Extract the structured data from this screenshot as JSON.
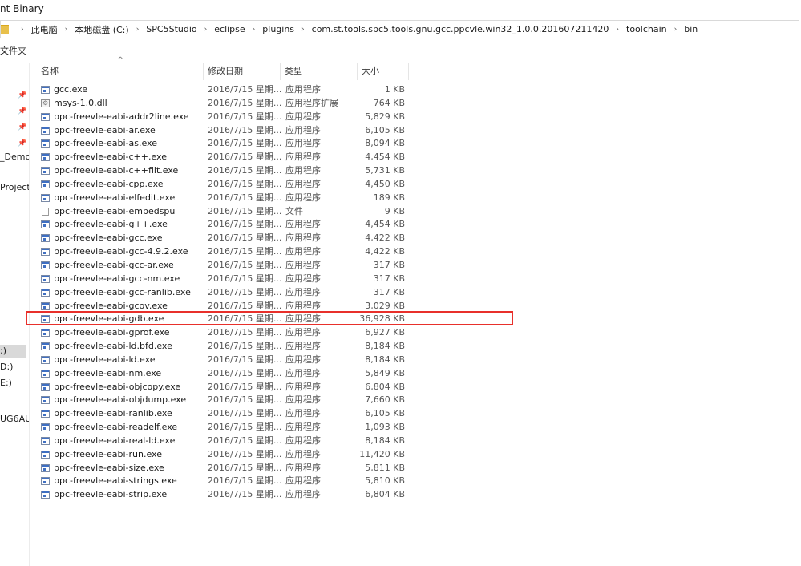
{
  "window": {
    "title": "nt Binary"
  },
  "address": {
    "crumbs": [
      "此电脑",
      "本地磁盘 (C:)",
      "SPC5Studio",
      "eclipse",
      "plugins",
      "com.st.tools.spc5.tools.gnu.gcc.ppcvle.win32_1.0.0.201607211420",
      "toolchain",
      "bin"
    ]
  },
  "commands": {
    "new_folder": "文件夹"
  },
  "nav": {
    "items": [
      "_Demo",
      "Project",
      ":)",
      "D:)",
      "E:)",
      "UG6AU"
    ],
    "selected_index": 2
  },
  "columns": {
    "name": "名称",
    "date": "修改日期",
    "type": "类型",
    "size": "大小"
  },
  "files": [
    {
      "name": "gcc.exe",
      "date": "2016/7/15 星期...",
      "type": "应用程序",
      "size": "1 KB",
      "icon": "exe"
    },
    {
      "name": "msys-1.0.dll",
      "date": "2016/7/15 星期...",
      "type": "应用程序扩展",
      "size": "764 KB",
      "icon": "dll"
    },
    {
      "name": "ppc-freevle-eabi-addr2line.exe",
      "date": "2016/7/15 星期...",
      "type": "应用程序",
      "size": "5,829 KB",
      "icon": "exe"
    },
    {
      "name": "ppc-freevle-eabi-ar.exe",
      "date": "2016/7/15 星期...",
      "type": "应用程序",
      "size": "6,105 KB",
      "icon": "exe"
    },
    {
      "name": "ppc-freevle-eabi-as.exe",
      "date": "2016/7/15 星期...",
      "type": "应用程序",
      "size": "8,094 KB",
      "icon": "exe"
    },
    {
      "name": "ppc-freevle-eabi-c++.exe",
      "date": "2016/7/15 星期...",
      "type": "应用程序",
      "size": "4,454 KB",
      "icon": "exe"
    },
    {
      "name": "ppc-freevle-eabi-c++filt.exe",
      "date": "2016/7/15 星期...",
      "type": "应用程序",
      "size": "5,731 KB",
      "icon": "exe"
    },
    {
      "name": "ppc-freevle-eabi-cpp.exe",
      "date": "2016/7/15 星期...",
      "type": "应用程序",
      "size": "4,450 KB",
      "icon": "exe"
    },
    {
      "name": "ppc-freevle-eabi-elfedit.exe",
      "date": "2016/7/15 星期...",
      "type": "应用程序",
      "size": "189 KB",
      "icon": "exe"
    },
    {
      "name": "ppc-freevle-eabi-embedspu",
      "date": "2016/7/15 星期...",
      "type": "文件",
      "size": "9 KB",
      "icon": "file"
    },
    {
      "name": "ppc-freevle-eabi-g++.exe",
      "date": "2016/7/15 星期...",
      "type": "应用程序",
      "size": "4,454 KB",
      "icon": "exe"
    },
    {
      "name": "ppc-freevle-eabi-gcc.exe",
      "date": "2016/7/15 星期...",
      "type": "应用程序",
      "size": "4,422 KB",
      "icon": "exe"
    },
    {
      "name": "ppc-freevle-eabi-gcc-4.9.2.exe",
      "date": "2016/7/15 星期...",
      "type": "应用程序",
      "size": "4,422 KB",
      "icon": "exe"
    },
    {
      "name": "ppc-freevle-eabi-gcc-ar.exe",
      "date": "2016/7/15 星期...",
      "type": "应用程序",
      "size": "317 KB",
      "icon": "exe"
    },
    {
      "name": "ppc-freevle-eabi-gcc-nm.exe",
      "date": "2016/7/15 星期...",
      "type": "应用程序",
      "size": "317 KB",
      "icon": "exe"
    },
    {
      "name": "ppc-freevle-eabi-gcc-ranlib.exe",
      "date": "2016/7/15 星期...",
      "type": "应用程序",
      "size": "317 KB",
      "icon": "exe"
    },
    {
      "name": "ppc-freevle-eabi-gcov.exe",
      "date": "2016/7/15 星期...",
      "type": "应用程序",
      "size": "3,029 KB",
      "icon": "exe"
    },
    {
      "name": "ppc-freevle-eabi-gdb.exe",
      "date": "2016/7/15 星期...",
      "type": "应用程序",
      "size": "36,928 KB",
      "icon": "exe"
    },
    {
      "name": "ppc-freevle-eabi-gprof.exe",
      "date": "2016/7/15 星期...",
      "type": "应用程序",
      "size": "6,927 KB",
      "icon": "exe"
    },
    {
      "name": "ppc-freevle-eabi-ld.bfd.exe",
      "date": "2016/7/15 星期...",
      "type": "应用程序",
      "size": "8,184 KB",
      "icon": "exe"
    },
    {
      "name": "ppc-freevle-eabi-ld.exe",
      "date": "2016/7/15 星期...",
      "type": "应用程序",
      "size": "8,184 KB",
      "icon": "exe"
    },
    {
      "name": "ppc-freevle-eabi-nm.exe",
      "date": "2016/7/15 星期...",
      "type": "应用程序",
      "size": "5,849 KB",
      "icon": "exe"
    },
    {
      "name": "ppc-freevle-eabi-objcopy.exe",
      "date": "2016/7/15 星期...",
      "type": "应用程序",
      "size": "6,804 KB",
      "icon": "exe"
    },
    {
      "name": "ppc-freevle-eabi-objdump.exe",
      "date": "2016/7/15 星期...",
      "type": "应用程序",
      "size": "7,660 KB",
      "icon": "exe"
    },
    {
      "name": "ppc-freevle-eabi-ranlib.exe",
      "date": "2016/7/15 星期...",
      "type": "应用程序",
      "size": "6,105 KB",
      "icon": "exe"
    },
    {
      "name": "ppc-freevle-eabi-readelf.exe",
      "date": "2016/7/15 星期...",
      "type": "应用程序",
      "size": "1,093 KB",
      "icon": "exe"
    },
    {
      "name": "ppc-freevle-eabi-real-ld.exe",
      "date": "2016/7/15 星期...",
      "type": "应用程序",
      "size": "8,184 KB",
      "icon": "exe"
    },
    {
      "name": "ppc-freevle-eabi-run.exe",
      "date": "2016/7/15 星期...",
      "type": "应用程序",
      "size": "11,420 KB",
      "icon": "exe"
    },
    {
      "name": "ppc-freevle-eabi-size.exe",
      "date": "2016/7/15 星期...",
      "type": "应用程序",
      "size": "5,811 KB",
      "icon": "exe"
    },
    {
      "name": "ppc-freevle-eabi-strings.exe",
      "date": "2016/7/15 星期...",
      "type": "应用程序",
      "size": "5,810 KB",
      "icon": "exe"
    },
    {
      "name": "ppc-freevle-eabi-strip.exe",
      "date": "2016/7/15 星期...",
      "type": "应用程序",
      "size": "6,804 KB",
      "icon": "exe"
    }
  ],
  "highlight": {
    "row_index": 17,
    "color": "#e8302b"
  },
  "icons": {
    "folder": "folder-icon",
    "pin": "pin-icon",
    "exe": "exe-file-icon",
    "dll": "dll-file-icon",
    "file": "generic-file-icon"
  }
}
